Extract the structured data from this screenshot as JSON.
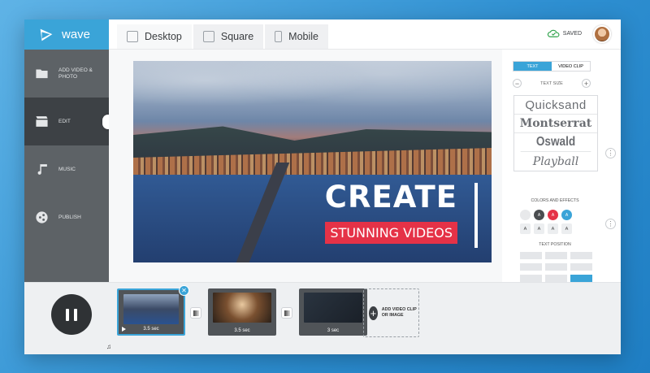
{
  "app": {
    "brand": "wave",
    "accent": "#3aa4d8"
  },
  "sidebar": {
    "items": [
      {
        "label": "ADD VIDEO & PHOTO",
        "icon": "film-folder-icon"
      },
      {
        "label": "EDIT",
        "icon": "clapperboard-icon",
        "active": true
      },
      {
        "label": "MUSIC",
        "icon": "music-note-icon"
      },
      {
        "label": "PUBLISH",
        "icon": "share-icon"
      }
    ]
  },
  "header": {
    "tabs": [
      {
        "label": "Desktop",
        "active": true
      },
      {
        "label": "Square"
      },
      {
        "label": "Mobile"
      }
    ],
    "saved_label": "SAVED"
  },
  "preview": {
    "headline": "CREATE",
    "subline": "STUNNING VIDEOS"
  },
  "panel": {
    "toggle": {
      "text": "TEXT",
      "video_clip": "VIDEO CLIP"
    },
    "text_size_label": "TEXT SIZE",
    "fonts": [
      "Quicksand",
      "Montserrat",
      "Oswald",
      "Playball"
    ],
    "colors_label": "COLORS AND EFFECTS",
    "swatches": [
      {
        "color": "#e8e9eb",
        "label": ""
      },
      {
        "color": "#4a4d50",
        "label": "A"
      },
      {
        "color": "#e53247",
        "label": "A"
      },
      {
        "color": "#3aa4d8",
        "label": "A"
      }
    ],
    "effects": [
      "A",
      "A",
      "A",
      "A"
    ],
    "text_position_label": "TEXT POSITION"
  },
  "timeline": {
    "clips": [
      {
        "duration": "3.5 sec",
        "selected": true
      },
      {
        "duration": "3.5 sec"
      },
      {
        "duration": "3 sec"
      }
    ],
    "add_label": "ADD VIDEO CLIP OR IMAGE"
  }
}
